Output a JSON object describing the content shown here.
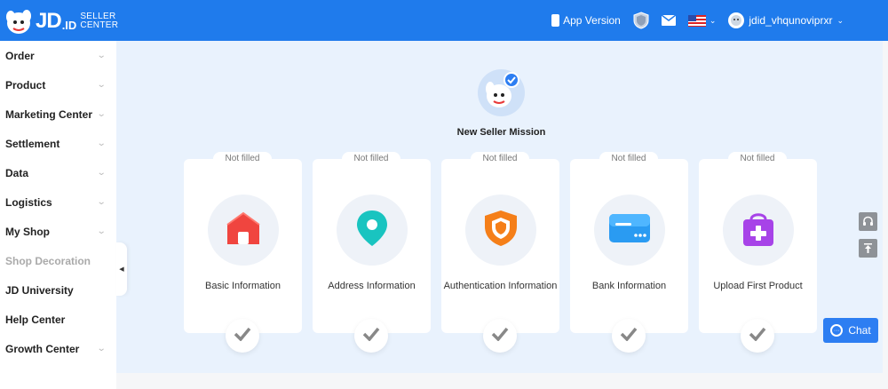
{
  "brand": {
    "logo_main": "JD",
    "logo_id": ".ID",
    "logo_sub_1": "SELLER",
    "logo_sub_2": "CENTER",
    "primary_color": "#1f7bec"
  },
  "header": {
    "app_version_label": "App Version",
    "username": "jdid_vhqunoviprxr",
    "caret": "⌄",
    "icons": [
      "phone-icon",
      "security-shield-icon",
      "mail-icon",
      "us-flag-icon",
      "avatar-icon"
    ]
  },
  "sidebar": {
    "items": [
      {
        "label": "Order",
        "caret": "⌄"
      },
      {
        "label": "Product",
        "caret": "⌄"
      },
      {
        "label": "Marketing Center",
        "caret": "⌄"
      },
      {
        "label": "Settlement",
        "caret": "⌄"
      },
      {
        "label": "Data",
        "caret": "⌄"
      },
      {
        "label": "Logistics",
        "caret": "⌄"
      },
      {
        "label": "My Shop",
        "caret": "⌄"
      },
      {
        "label": "Shop Decoration",
        "caret": ""
      },
      {
        "label": "JD University",
        "caret": ""
      },
      {
        "label": "Help Center",
        "caret": ""
      },
      {
        "label": "Growth Center",
        "caret": "⌄"
      }
    ],
    "collapse_glyph": "◀"
  },
  "mission": {
    "title": "New Seller Mission",
    "cards": [
      {
        "status": "Not filled",
        "label": "Basic Information",
        "icon": "shop-icon",
        "color": "#f0453f"
      },
      {
        "status": "Not filled",
        "label": "Address Information",
        "icon": "location-pin-icon",
        "color": "#19c4c0"
      },
      {
        "status": "Not filled",
        "label": "Authentication Information",
        "icon": "shield-icon",
        "color": "#f57f19"
      },
      {
        "status": "Not filled",
        "label": "Bank Information",
        "icon": "bank-card-icon",
        "color": "#2a9bf2"
      },
      {
        "status": "Not filled",
        "label": "Upload First Product",
        "icon": "shopping-bag-plus-icon",
        "color": "#a743e8"
      }
    ]
  },
  "chat": {
    "label": "Chat"
  }
}
